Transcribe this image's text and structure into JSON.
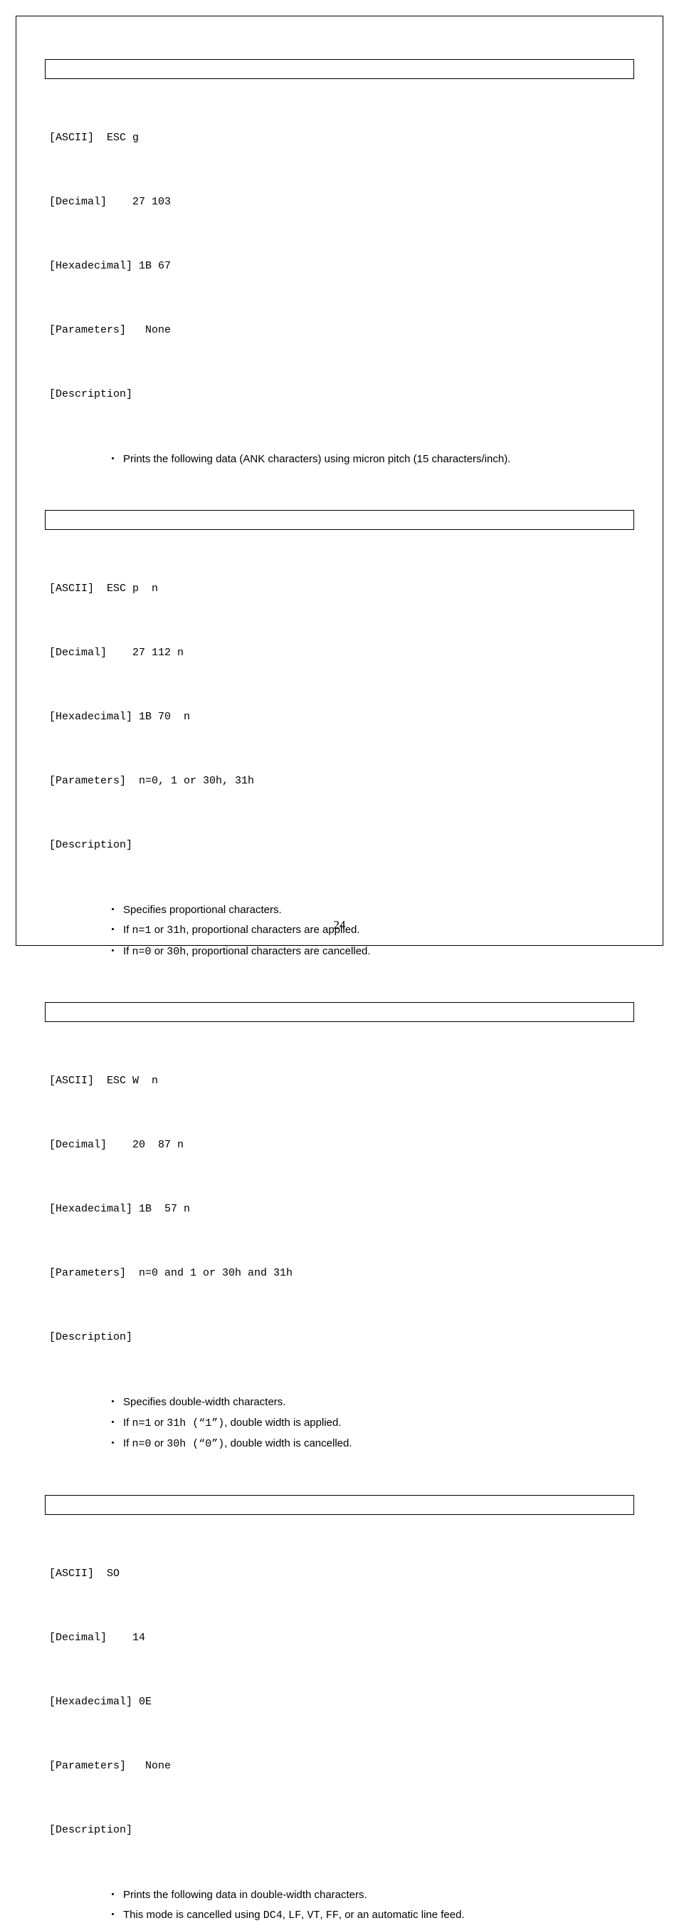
{
  "sections": [
    {
      "ascii": "[ASCII]  ESC g",
      "decimal": "[Decimal]    27 103",
      "hex": "[Hexadecimal] 1B 67",
      "params": "[Parameters]   None",
      "desc_label": "[Description]",
      "bullets": [
        {
          "pre": "",
          "mid_mono": "",
          "text": "Prints the following data (ANK characters) using micron pitch (15 characters/inch)."
        }
      ]
    },
    {
      "ascii": "[ASCII]  ESC p  n",
      "decimal": "[Decimal]    27 112 n",
      "hex": "[Hexadecimal] 1B 70  n",
      "params": "[Parameters]  n=0, 1 or 30h, 31h",
      "desc_label": "[Description]",
      "bullets": [
        {
          "text": "Specifies proportional characters."
        },
        {
          "pre": "If ",
          "mono1": "n=1",
          "mid": " or ",
          "mono2": "31h",
          "post": ", proportional characters are applied."
        },
        {
          "pre": "If ",
          "mono1": "n=0",
          "mid": " or ",
          "mono2": "30h",
          "post": ", proportional characters are cancelled."
        }
      ]
    },
    {
      "ascii": "[ASCII]  ESC W  n",
      "decimal": "[Decimal]    20  87 n",
      "hex": "[Hexadecimal] 1B  57 n",
      "params": "[Parameters]  n=0 and 1 or 30h and 31h",
      "desc_label": "[Description]",
      "bullets": [
        {
          "text": "Specifies double-width characters."
        },
        {
          "pre": "If ",
          "mono1": "n=1",
          "mid": " or ",
          "mono2": "31h (“1”)",
          "post": ", double width is applied."
        },
        {
          "pre": "If ",
          "mono1": "n=0",
          "mid": " or ",
          "mono2": "30h (“0”)",
          "post": ", double width is cancelled."
        }
      ]
    },
    {
      "ascii": "[ASCII]  SO",
      "decimal": "[Decimal]    14",
      "hex": "[Hexadecimal] 0E",
      "params": "[Parameters]   None",
      "desc_label": "[Description]",
      "bullets": [
        {
          "text": "Prints the following data in double-width characters."
        },
        {
          "pre": "This mode is cancelled using ",
          "mono1": "DC4",
          "mid": ", ",
          "mono2": "LF",
          "mid2": ", ",
          "mono3": "VT",
          "mid3": ", ",
          "mono4": "FF",
          "post": ", or an automatic line feed."
        }
      ]
    }
  ],
  "page_number": "24",
  "bullet_char": "・"
}
